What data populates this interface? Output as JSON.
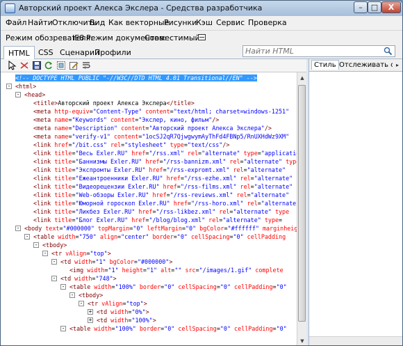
{
  "window": {
    "title": "Авторский проект Алекса Экслера - Средства разработчика",
    "min_label": "–",
    "max_label": "□",
    "close_label": "X"
  },
  "menu": {
    "items": [
      "Файл",
      "Найти",
      "Отключить",
      "Вид",
      "Как векторные",
      "Рисунки",
      "Кэш",
      "Сервис",
      "Проверка"
    ]
  },
  "modes": {
    "browser_label": "Режим обозревателя:",
    "browser_value": "IE8",
    "document_label": "Режим документов:",
    "document_value": "Совместимый"
  },
  "tabs": [
    "HTML",
    "CSS",
    "Сценарий",
    "Профили"
  ],
  "search": {
    "placeholder": "Найти HTML"
  },
  "right_pane": {
    "tabs": [
      "Стиль",
      "Отслеживать ст"
    ]
  },
  "icons": {
    "select": "cursor-arrow-icon",
    "clear": "clear-icon",
    "save": "save-icon",
    "refresh": "refresh-icon",
    "outline": "outline-icon",
    "edit": "edit-icon",
    "word_wrap": "word-wrap-icon",
    "search": "search-icon"
  },
  "colors": {
    "tag": "#800000",
    "attr": "#ff0000",
    "value": "#0000ff",
    "selection": "#3399ff"
  },
  "tree": [
    {
      "indent": 0,
      "exp": "",
      "sel": true,
      "segs": [
        {
          "c": "x",
          "t": "<!-- DOCTYPE HTML PUBLIC \"-//W3C//DTD HTML 4.01 Transitional//EN\" -->"
        }
      ]
    },
    {
      "indent": 0,
      "exp": "-",
      "segs": [
        {
          "c": "t",
          "t": "<html>"
        }
      ]
    },
    {
      "indent": 1,
      "exp": "-",
      "segs": [
        {
          "c": "t",
          "t": "<head>"
        }
      ]
    },
    {
      "indent": 2,
      "exp": "",
      "segs": [
        {
          "c": "t",
          "t": "<title>"
        },
        {
          "c": "x",
          "t": "Авторский проект Алекса Экслера"
        },
        {
          "c": "t",
          "t": "</title>"
        }
      ]
    },
    {
      "indent": 2,
      "exp": "",
      "segs": [
        {
          "c": "t",
          "t": "<meta "
        },
        {
          "c": "a",
          "t": "http-equiv"
        },
        {
          "c": "x",
          "t": "="
        },
        {
          "c": "v",
          "t": "\"Content-Type\""
        },
        {
          "c": "a",
          "t": " content"
        },
        {
          "c": "x",
          "t": "="
        },
        {
          "c": "v",
          "t": "\"text/html; charset=windows-1251\""
        }
      ]
    },
    {
      "indent": 2,
      "exp": "",
      "segs": [
        {
          "c": "t",
          "t": "<meta "
        },
        {
          "c": "a",
          "t": "name"
        },
        {
          "c": "x",
          "t": "="
        },
        {
          "c": "v",
          "t": "\"Keywords\""
        },
        {
          "c": "a",
          "t": " content"
        },
        {
          "c": "x",
          "t": "="
        },
        {
          "c": "v",
          "t": "\"Экслер, кино, фильм\""
        },
        {
          "c": "t",
          "t": "/>"
        }
      ]
    },
    {
      "indent": 2,
      "exp": "",
      "segs": [
        {
          "c": "t",
          "t": "<meta "
        },
        {
          "c": "a",
          "t": "name"
        },
        {
          "c": "x",
          "t": "="
        },
        {
          "c": "v",
          "t": "\"Description\""
        },
        {
          "c": "a",
          "t": " content"
        },
        {
          "c": "x",
          "t": "="
        },
        {
          "c": "v",
          "t": "\"Авторский проект Алекса Экслера\""
        },
        {
          "c": "t",
          "t": "/>"
        }
      ]
    },
    {
      "indent": 2,
      "exp": "",
      "segs": [
        {
          "c": "t",
          "t": "<meta "
        },
        {
          "c": "a",
          "t": "name"
        },
        {
          "c": "x",
          "t": "="
        },
        {
          "c": "v",
          "t": "\"verify-v1\""
        },
        {
          "c": "a",
          "t": " content"
        },
        {
          "c": "x",
          "t": "="
        },
        {
          "c": "v",
          "t": "\"1ocSJ2qR7QjwgwymAyThFd4FBNp5/RnUXHdWz9XM\""
        }
      ]
    },
    {
      "indent": 2,
      "exp": "",
      "segs": [
        {
          "c": "t",
          "t": "<link "
        },
        {
          "c": "a",
          "t": "href"
        },
        {
          "c": "x",
          "t": "="
        },
        {
          "c": "v",
          "t": "\"/bit.css\""
        },
        {
          "c": "a",
          "t": " rel"
        },
        {
          "c": "x",
          "t": "="
        },
        {
          "c": "v",
          "t": "\"stylesheet\""
        },
        {
          "c": "a",
          "t": " type"
        },
        {
          "c": "x",
          "t": "="
        },
        {
          "c": "v",
          "t": "\"text/css\""
        },
        {
          "c": "t",
          "t": "/>"
        }
      ]
    },
    {
      "indent": 2,
      "exp": "",
      "segs": [
        {
          "c": "t",
          "t": "<link "
        },
        {
          "c": "a",
          "t": "title"
        },
        {
          "c": "x",
          "t": "="
        },
        {
          "c": "v",
          "t": "\"Весь Exler.RU\""
        },
        {
          "c": "a",
          "t": " href"
        },
        {
          "c": "x",
          "t": "="
        },
        {
          "c": "v",
          "t": "\"/rss.xml\""
        },
        {
          "c": "a",
          "t": " rel"
        },
        {
          "c": "x",
          "t": "="
        },
        {
          "c": "v",
          "t": "\"alternate\""
        },
        {
          "c": "a",
          "t": " type"
        },
        {
          "c": "x",
          "t": "="
        },
        {
          "c": "v",
          "t": "\"application/rss+xml\""
        }
      ]
    },
    {
      "indent": 2,
      "exp": "",
      "segs": [
        {
          "c": "t",
          "t": "<link "
        },
        {
          "c": "a",
          "t": "title"
        },
        {
          "c": "x",
          "t": "="
        },
        {
          "c": "v",
          "t": "\"Баннизмы Exler.RU\""
        },
        {
          "c": "a",
          "t": " href"
        },
        {
          "c": "x",
          "t": "="
        },
        {
          "c": "v",
          "t": "\"/rss-bannizm.xml\""
        },
        {
          "c": "a",
          "t": " rel"
        },
        {
          "c": "x",
          "t": "="
        },
        {
          "c": "v",
          "t": "\"alternate\""
        },
        {
          "c": "a",
          "t": " type"
        }
      ]
    },
    {
      "indent": 2,
      "exp": "",
      "segs": [
        {
          "c": "t",
          "t": "<link "
        },
        {
          "c": "a",
          "t": "title"
        },
        {
          "c": "x",
          "t": "="
        },
        {
          "c": "v",
          "t": "\"Экспромты Exler.RU\""
        },
        {
          "c": "a",
          "t": " href"
        },
        {
          "c": "x",
          "t": "="
        },
        {
          "c": "v",
          "t": "\"/rss-expromt.xml\""
        },
        {
          "c": "a",
          "t": " rel"
        },
        {
          "c": "x",
          "t": "="
        },
        {
          "c": "v",
          "t": "\"alternate\""
        }
      ]
    },
    {
      "indent": 2,
      "exp": "",
      "segs": [
        {
          "c": "t",
          "t": "<link "
        },
        {
          "c": "a",
          "t": "title"
        },
        {
          "c": "x",
          "t": "="
        },
        {
          "c": "v",
          "t": "\"Ежеантроенники Exler.RU\""
        },
        {
          "c": "a",
          "t": " href"
        },
        {
          "c": "x",
          "t": "="
        },
        {
          "c": "v",
          "t": "\"/rss-ezhe.xml\""
        },
        {
          "c": "a",
          "t": " rel"
        },
        {
          "c": "x",
          "t": "="
        },
        {
          "c": "v",
          "t": "\"alternate\""
        }
      ]
    },
    {
      "indent": 2,
      "exp": "",
      "segs": [
        {
          "c": "t",
          "t": "<link "
        },
        {
          "c": "a",
          "t": "title"
        },
        {
          "c": "x",
          "t": "="
        },
        {
          "c": "v",
          "t": "\"Видеорецензии Exler.RU\""
        },
        {
          "c": "a",
          "t": " href"
        },
        {
          "c": "x",
          "t": "="
        },
        {
          "c": "v",
          "t": "\"/rss-films.xml\""
        },
        {
          "c": "a",
          "t": " rel"
        },
        {
          "c": "x",
          "t": "="
        },
        {
          "c": "v",
          "t": "\"alternate\""
        }
      ]
    },
    {
      "indent": 2,
      "exp": "",
      "segs": [
        {
          "c": "t",
          "t": "<link "
        },
        {
          "c": "a",
          "t": "title"
        },
        {
          "c": "x",
          "t": "="
        },
        {
          "c": "v",
          "t": "\"Web-обзоры Exler.RU\""
        },
        {
          "c": "a",
          "t": " href"
        },
        {
          "c": "x",
          "t": "="
        },
        {
          "c": "v",
          "t": "\"/rss-reviews.xml\""
        },
        {
          "c": "a",
          "t": " rel"
        },
        {
          "c": "x",
          "t": "="
        },
        {
          "c": "v",
          "t": "\"alternate\""
        }
      ]
    },
    {
      "indent": 2,
      "exp": "",
      "segs": [
        {
          "c": "t",
          "t": "<link "
        },
        {
          "c": "a",
          "t": "title"
        },
        {
          "c": "x",
          "t": "="
        },
        {
          "c": "v",
          "t": "\"Юморной гороскоп Exler.RU\""
        },
        {
          "c": "a",
          "t": " href"
        },
        {
          "c": "x",
          "t": "="
        },
        {
          "c": "v",
          "t": "\"/rss-horo.xml\""
        },
        {
          "c": "a",
          "t": " rel"
        },
        {
          "c": "x",
          "t": "="
        },
        {
          "c": "v",
          "t": "\"alternate\""
        }
      ]
    },
    {
      "indent": 2,
      "exp": "",
      "segs": [
        {
          "c": "t",
          "t": "<link "
        },
        {
          "c": "a",
          "t": "title"
        },
        {
          "c": "x",
          "t": "="
        },
        {
          "c": "v",
          "t": "\"Ликбез Exler.RU\""
        },
        {
          "c": "a",
          "t": " href"
        },
        {
          "c": "x",
          "t": "="
        },
        {
          "c": "v",
          "t": "\"/rss-likbez.xml\""
        },
        {
          "c": "a",
          "t": " rel"
        },
        {
          "c": "x",
          "t": "="
        },
        {
          "c": "v",
          "t": "\"alternate\""
        },
        {
          "c": "a",
          "t": " type"
        }
      ]
    },
    {
      "indent": 2,
      "exp": "",
      "segs": [
        {
          "c": "t",
          "t": "<link "
        },
        {
          "c": "a",
          "t": "title"
        },
        {
          "c": "x",
          "t": "="
        },
        {
          "c": "v",
          "t": "\"Блог Exler.RU\""
        },
        {
          "c": "a",
          "t": " href"
        },
        {
          "c": "x",
          "t": "="
        },
        {
          "c": "v",
          "t": "\"/blog/blog.xml\""
        },
        {
          "c": "a",
          "t": " rel"
        },
        {
          "c": "x",
          "t": "="
        },
        {
          "c": "v",
          "t": "\"alternate\""
        },
        {
          "c": "a",
          "t": " type"
        },
        {
          "c": "x",
          "t": "="
        }
      ]
    },
    {
      "indent": 1,
      "exp": "-",
      "segs": [
        {
          "c": "t",
          "t": "<body "
        },
        {
          "c": "a",
          "t": "text"
        },
        {
          "c": "x",
          "t": "="
        },
        {
          "c": "v",
          "t": "\"#000000\""
        },
        {
          "c": "a",
          "t": " topMargin"
        },
        {
          "c": "x",
          "t": "="
        },
        {
          "c": "v",
          "t": "\"0\""
        },
        {
          "c": "a",
          "t": " leftMargin"
        },
        {
          "c": "x",
          "t": "="
        },
        {
          "c": "v",
          "t": "\"0\""
        },
        {
          "c": "a",
          "t": " bgColor"
        },
        {
          "c": "x",
          "t": "="
        },
        {
          "c": "v",
          "t": "\"#ffffff\""
        },
        {
          "c": "a",
          "t": " marginheight"
        }
      ]
    },
    {
      "indent": 2,
      "exp": "-",
      "segs": [
        {
          "c": "t",
          "t": "<table "
        },
        {
          "c": "a",
          "t": "width"
        },
        {
          "c": "x",
          "t": "="
        },
        {
          "c": "v",
          "t": "\"750\""
        },
        {
          "c": "a",
          "t": " align"
        },
        {
          "c": "x",
          "t": "="
        },
        {
          "c": "v",
          "t": "\"center\""
        },
        {
          "c": "a",
          "t": " border"
        },
        {
          "c": "x",
          "t": "="
        },
        {
          "c": "v",
          "t": "\"0\""
        },
        {
          "c": "a",
          "t": " cellSpacing"
        },
        {
          "c": "x",
          "t": "="
        },
        {
          "c": "v",
          "t": "\"0\""
        },
        {
          "c": "a",
          "t": " cellPadding"
        }
      ]
    },
    {
      "indent": 3,
      "exp": "-",
      "segs": [
        {
          "c": "t",
          "t": "<tbody>"
        }
      ]
    },
    {
      "indent": 4,
      "exp": "-",
      "segs": [
        {
          "c": "t",
          "t": "<tr "
        },
        {
          "c": "a",
          "t": "vAlign"
        },
        {
          "c": "x",
          "t": "="
        },
        {
          "c": "v",
          "t": "\"top\""
        },
        {
          "c": "t",
          "t": ">"
        }
      ]
    },
    {
      "indent": 5,
      "exp": "-",
      "segs": [
        {
          "c": "t",
          "t": "<td "
        },
        {
          "c": "a",
          "t": "width"
        },
        {
          "c": "x",
          "t": "="
        },
        {
          "c": "v",
          "t": "\"1\""
        },
        {
          "c": "a",
          "t": " bgColor"
        },
        {
          "c": "x",
          "t": "="
        },
        {
          "c": "v",
          "t": "\"#000000\""
        },
        {
          "c": "t",
          "t": ">"
        }
      ]
    },
    {
      "indent": 6,
      "exp": "",
      "segs": [
        {
          "c": "t",
          "t": "<img "
        },
        {
          "c": "a",
          "t": "width"
        },
        {
          "c": "x",
          "t": "="
        },
        {
          "c": "v",
          "t": "\"1\""
        },
        {
          "c": "a",
          "t": " height"
        },
        {
          "c": "x",
          "t": "="
        },
        {
          "c": "v",
          "t": "\"1\""
        },
        {
          "c": "a",
          "t": " alt"
        },
        {
          "c": "x",
          "t": "="
        },
        {
          "c": "v",
          "t": "\"\""
        },
        {
          "c": "a",
          "t": " src"
        },
        {
          "c": "x",
          "t": "="
        },
        {
          "c": "v",
          "t": "\"/images/1.gif\""
        },
        {
          "c": "a",
          "t": " complete"
        }
      ]
    },
    {
      "indent": 5,
      "exp": "-",
      "segs": [
        {
          "c": "t",
          "t": "<td "
        },
        {
          "c": "a",
          "t": "width"
        },
        {
          "c": "x",
          "t": "="
        },
        {
          "c": "v",
          "t": "\"748\""
        },
        {
          "c": "t",
          "t": ">"
        }
      ]
    },
    {
      "indent": 6,
      "exp": "-",
      "segs": [
        {
          "c": "t",
          "t": "<table "
        },
        {
          "c": "a",
          "t": "width"
        },
        {
          "c": "x",
          "t": "="
        },
        {
          "c": "v",
          "t": "\"100%\""
        },
        {
          "c": "a",
          "t": " border"
        },
        {
          "c": "x",
          "t": "="
        },
        {
          "c": "v",
          "t": "\"0\""
        },
        {
          "c": "a",
          "t": " cellSpacing"
        },
        {
          "c": "x",
          "t": "="
        },
        {
          "c": "v",
          "t": "\"0\""
        },
        {
          "c": "a",
          "t": " cellPadding"
        },
        {
          "c": "x",
          "t": "="
        },
        {
          "c": "v",
          "t": "\"0\""
        }
      ]
    },
    {
      "indent": 7,
      "exp": "-",
      "segs": [
        {
          "c": "t",
          "t": "<tbody>"
        }
      ]
    },
    {
      "indent": 8,
      "exp": "-",
      "segs": [
        {
          "c": "t",
          "t": "<tr "
        },
        {
          "c": "a",
          "t": "vAlign"
        },
        {
          "c": "x",
          "t": "="
        },
        {
          "c": "v",
          "t": "\"top\""
        },
        {
          "c": "t",
          "t": ">"
        }
      ]
    },
    {
      "indent": 9,
      "exp": "+",
      "segs": [
        {
          "c": "t",
          "t": "<td "
        },
        {
          "c": "a",
          "t": "width"
        },
        {
          "c": "x",
          "t": "="
        },
        {
          "c": "v",
          "t": "\"0%\""
        },
        {
          "c": "t",
          "t": ">"
        }
      ]
    },
    {
      "indent": 9,
      "exp": "+",
      "segs": [
        {
          "c": "t",
          "t": "<td "
        },
        {
          "c": "a",
          "t": "width"
        },
        {
          "c": "x",
          "t": "="
        },
        {
          "c": "v",
          "t": "\"100%\""
        },
        {
          "c": "t",
          "t": ">"
        }
      ]
    },
    {
      "indent": 6,
      "exp": "-",
      "segs": [
        {
          "c": "t",
          "t": "<table "
        },
        {
          "c": "a",
          "t": "width"
        },
        {
          "c": "x",
          "t": "="
        },
        {
          "c": "v",
          "t": "\"100%\""
        },
        {
          "c": "a",
          "t": " border"
        },
        {
          "c": "x",
          "t": "="
        },
        {
          "c": "v",
          "t": "\"0\""
        },
        {
          "c": "a",
          "t": " cellSpacing"
        },
        {
          "c": "x",
          "t": "="
        },
        {
          "c": "v",
          "t": "\"0\""
        },
        {
          "c": "a",
          "t": " cellPadding"
        },
        {
          "c": "x",
          "t": "="
        },
        {
          "c": "v",
          "t": "\"0\""
        }
      ]
    }
  ]
}
